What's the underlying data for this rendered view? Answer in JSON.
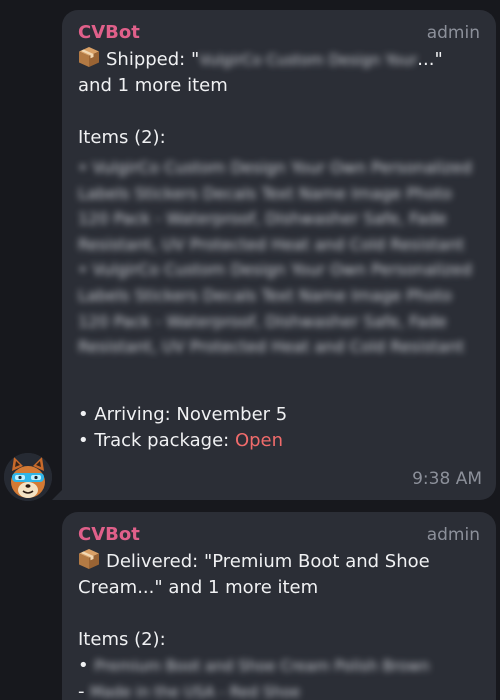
{
  "messages": [
    {
      "sender": "CVBot",
      "role": "admin",
      "title_prefix": "Shipped: \"",
      "title_blurred": "VulgirCo Custom Design Your",
      "title_suffix": "...\"",
      "title_line2": "and 1 more item",
      "items_heading": "Items (2):",
      "items_blurred": [
        "• VulgirCo Custom Design Your Own Personalized Labels Stickers Decals Text Name Image Photo 120 Pack - Waterproof, Dishwasher Safe, Fade Resistant, UV Protected Heat and Cold Resistant",
        "• VulgirCo Custom Design Your Own Personalized Labels Stickers Decals Text Name Image Photo 120 Pack - Waterproof, Dishwasher Safe, Fade Resistant, UV Protected Heat and Cold Resistant"
      ],
      "arriving": "• Arriving: November 5",
      "track_label": "• Track package: ",
      "track_link": "Open",
      "time": "9:38 AM"
    },
    {
      "sender": "CVBot",
      "role": "admin",
      "title_line1": "Delivered: \"Premium Boot and Shoe",
      "title_line2": "Cream...\" and 1 more item",
      "items_heading": "Items (2):",
      "item1_bullet": "•",
      "item1_blurred": "Premium Boot and Shoe Cream Polish Brown",
      "item2_bullet": "-",
      "item2_blurred": "Made in the USA - Red Shoe"
    }
  ],
  "colors": {
    "sender": "#e0608a",
    "link": "#f06b6b",
    "bubble": "#2b2e36",
    "background": "#17181d"
  },
  "icons": {
    "package": "package-icon",
    "avatar": "fox-avatar-icon"
  }
}
